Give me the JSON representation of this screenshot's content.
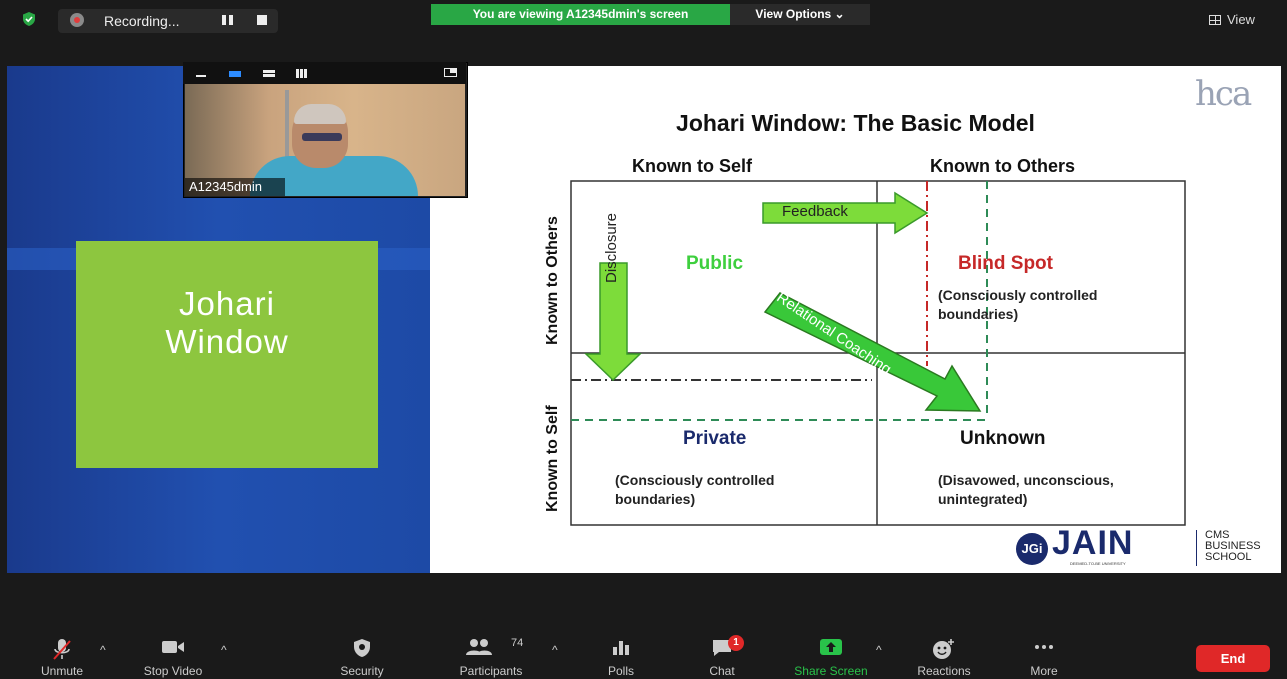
{
  "top_bar": {
    "recording_label": "Recording...",
    "viewing_banner": "You are viewing A12345dmin's screen",
    "view_options_label": "View Options ⌄",
    "view_label": "View"
  },
  "video_tile": {
    "participant_name": "A12345dmin"
  },
  "left_slide_panel": {
    "title_line1": "Johari",
    "title_line2": "Window"
  },
  "slide": {
    "title": "Johari Window: The Basic Model",
    "col_known_self": "Known to Self",
    "col_known_others": "Known to Others",
    "row_known_others": "Known to Others",
    "row_known_self": "Known to Self",
    "feedback_label": "Feedback",
    "disclosure_label": "Disclosure",
    "coaching_label": "Relational Coaching",
    "q_public": "Public",
    "q_blind": "Blind Spot",
    "q_blind_sub1": "(Consciously controlled",
    "q_blind_sub2": "boundaries)",
    "q_private": "Private",
    "q_private_sub1": "(Consciously controlled",
    "q_private_sub2": "boundaries)",
    "q_unknown": "Unknown",
    "q_unknown_sub1": "(Disavowed, unconscious,",
    "q_unknown_sub2": "unintegrated)",
    "logo_hca": "hca",
    "logo_jgi": "JGi",
    "logo_jain": "JAIN",
    "logo_jain_sub": "DEEMED-TO-BE UNIVERSITY",
    "logo_cms1": "CMS",
    "logo_cms2": "BUSINESS",
    "logo_cms3": "SCHOOL",
    "colors": {
      "public": "#3ecf3e",
      "blind": "#c62828",
      "arrow_green": "#7ddc3a",
      "arrow_dark": "#3a9a2a"
    }
  },
  "toolbar": {
    "unmute": "Unmute",
    "stop_video": "Stop Video",
    "security": "Security",
    "participants": "Participants",
    "participants_count": "74",
    "polls": "Polls",
    "chat": "Chat",
    "chat_badge": "1",
    "share_screen": "Share Screen",
    "reactions": "Reactions",
    "more": "More",
    "end": "End"
  }
}
